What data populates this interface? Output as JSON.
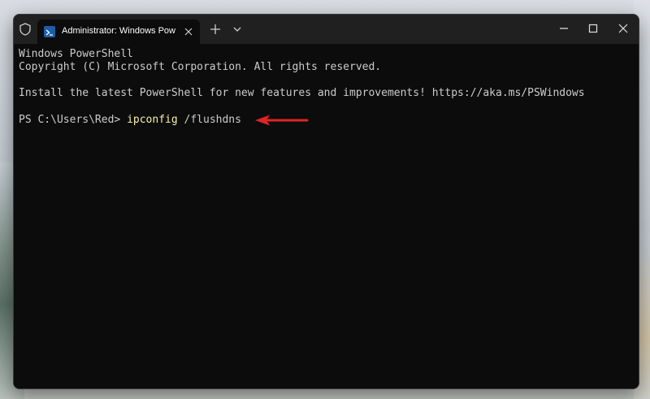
{
  "window": {
    "tab_title": "Administrator: Windows Powe",
    "new_tab_glyph": "+",
    "dropdown_icon": "chevron-down-icon",
    "tab_icon": "powershell-icon",
    "controls": [
      "minimize-icon",
      "maximize-icon",
      "close-icon"
    ]
  },
  "terminal": {
    "line1": "Windows PowerShell",
    "line2": "Copyright (C) Microsoft Corporation. All rights reserved.",
    "line3": "Install the latest PowerShell for new features and improvements! https://aka.ms/PSWindows",
    "prompt": "PS C:\\Users\\Red> ",
    "command": "ipconfig",
    "argument": " /flushdns"
  },
  "colors": {
    "command": "#f9f1a5",
    "annotation_arrow": "#e02424"
  }
}
